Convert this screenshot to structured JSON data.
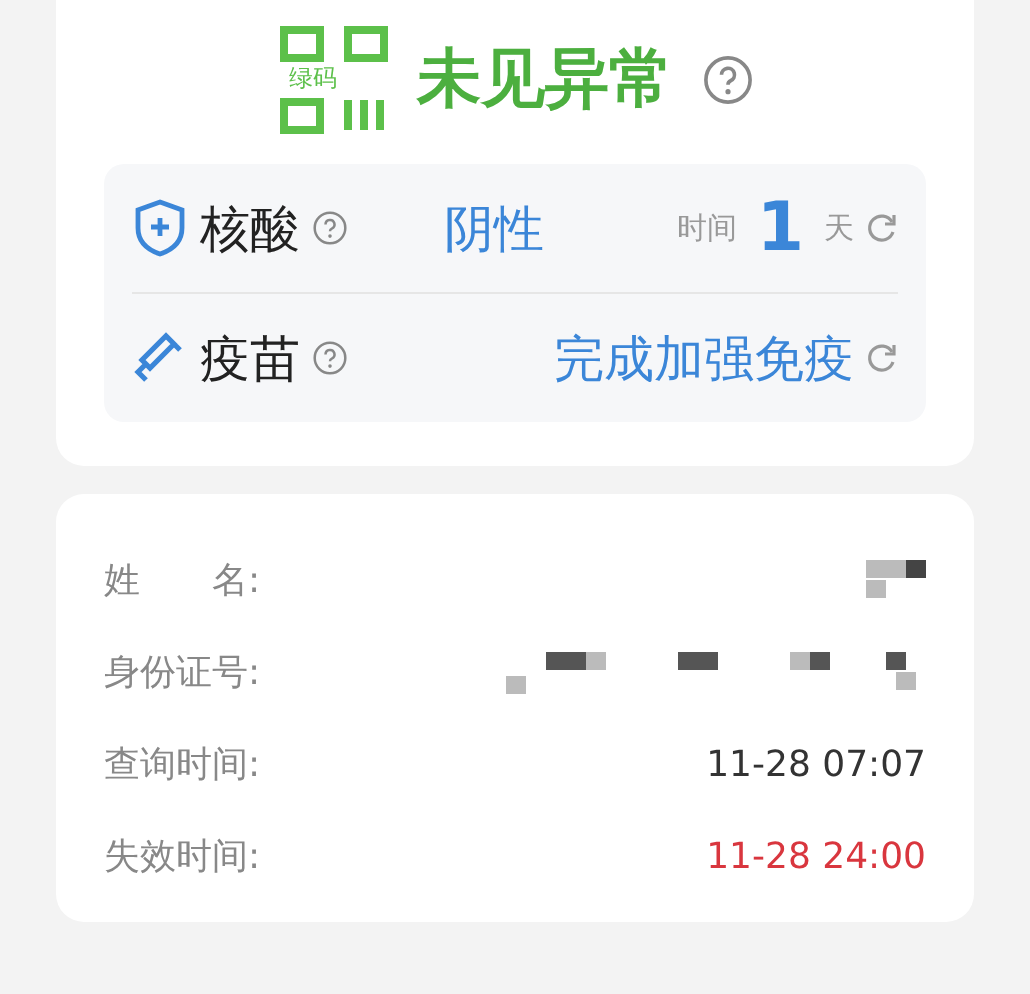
{
  "code_status": {
    "badge": "绿码",
    "title": "未见异常"
  },
  "checks": [
    {
      "kind": "nucleic",
      "label": "核酸",
      "result": "阴性",
      "time_label": "时间",
      "time_value": "1",
      "time_unit": "天"
    },
    {
      "kind": "vaccine",
      "label": "疫苗",
      "result": "完成加强免疫"
    }
  ],
  "info": [
    {
      "label": "姓　　名:",
      "redacted": true
    },
    {
      "label": "身份证号:",
      "redacted": true
    },
    {
      "label": "查询时间:",
      "value": "11-28 07:07",
      "color": "#333333"
    },
    {
      "label": "失效时间:",
      "value": "11-28 24:00",
      "color": "#d9363e"
    }
  ]
}
